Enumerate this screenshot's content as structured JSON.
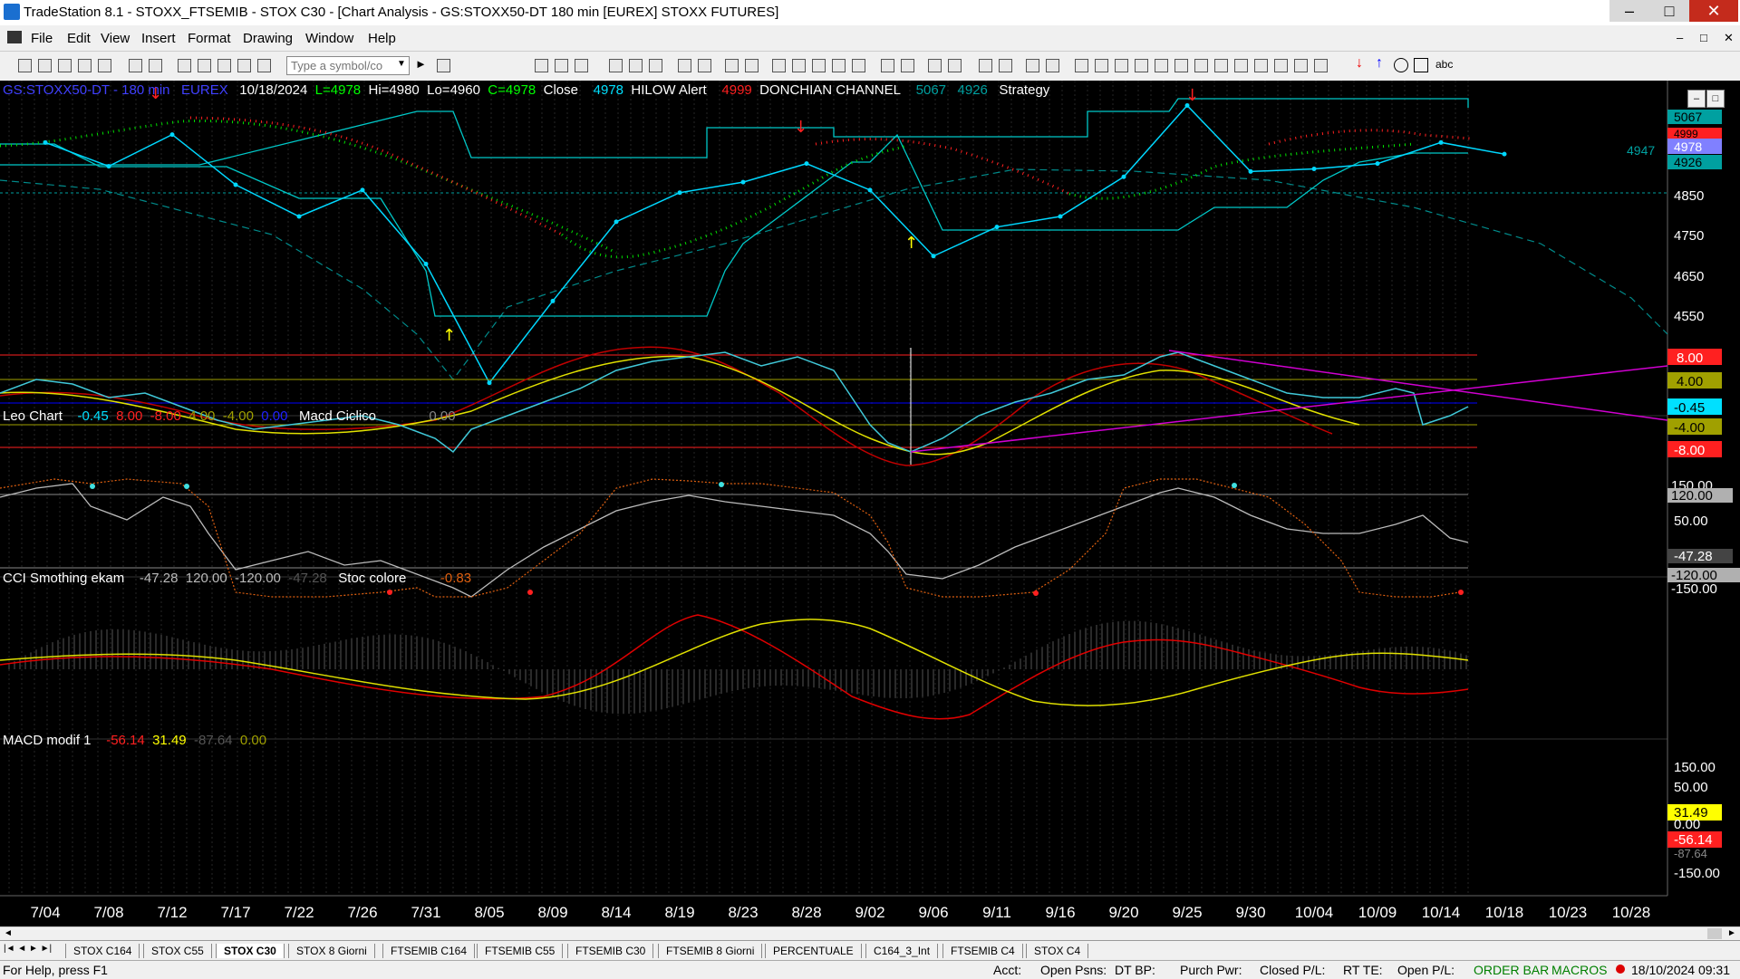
{
  "window": {
    "title": "TradeStation 8.1 - STOXX_FTSEMIB - STOX  C30 - [Chart Analysis - GS:STOXX50-DT  180 min  [EUREX] STOXX FUTURES]",
    "minimize": "–",
    "maximize": "□",
    "close": "✕"
  },
  "menu": [
    "File",
    "Edit",
    "View",
    "Insert",
    "Format",
    "Drawing",
    "Window",
    "Help"
  ],
  "toolbar": {
    "symbol_placeholder": "Type a symbol/co",
    "text_tool": "abc"
  },
  "header": {
    "symbol": "GS:STOXX50-DT - 180 min",
    "exchange": "EUREX",
    "date": "10/18/2024",
    "last": "L=4978",
    "hi": "Hi=4980",
    "lo": "Lo=4960",
    "close": "C=4978",
    "close_label": "Close",
    "close_val": "4978",
    "hilow": "HILOW Alert",
    "hilow_val": "4999",
    "donchian": "DONCHIAN CHANNEL",
    "don_up": "5067",
    "don_lo": "4926",
    "strategy": "Strategy"
  },
  "panel2": {
    "name": "Leo Chart",
    "v1": "-0.45",
    "v2": "8.00",
    "v3": "-8.00",
    "v4": "4.00",
    "v5": "-4.00",
    "v6": "0.00",
    "name2": "Macd Ciclico",
    "v7": "0.00"
  },
  "panel3": {
    "name": "CCI Smothing ekam",
    "v1": "-47.28",
    "v2": "120.00",
    "v3": "-120.00",
    "v4": "-47.28",
    "name2": "Stoc colore",
    "v5": "-0.83"
  },
  "panel4": {
    "name": "MACD modif 1",
    "v1": "-56.14",
    "v2": "31.49",
    "v3": "-87.64",
    "v4": "0.00"
  },
  "axis_price": [
    "4850",
    "4750",
    "4650",
    "4550"
  ],
  "axis_price_tags": {
    "up": "5067",
    "hilow": "4999",
    "close": "4978",
    "lo": "4926",
    "cursor": "4947"
  },
  "axis_leo": [
    "8.00",
    "4.00",
    "-0.45",
    "-4.00",
    "-8.00"
  ],
  "axis_cci": [
    "150.00",
    "120.00",
    "50.00",
    "-47.28",
    "-120.00",
    "-150.00"
  ],
  "axis_macd": [
    "150.00",
    "50.00",
    "31.49",
    "0.00",
    "-56.14",
    "-87.64",
    "-150.00"
  ],
  "dates": [
    "7/04",
    "7/08",
    "7/12",
    "7/17",
    "7/22",
    "7/26",
    "7/31",
    "8/05",
    "8/09",
    "8/14",
    "8/19",
    "8/23",
    "8/28",
    "9/02",
    "9/06",
    "9/11",
    "9/16",
    "9/20",
    "9/25",
    "9/30",
    "10/04",
    "10/09",
    "10/14",
    "10/18",
    "10/23",
    "10/28"
  ],
  "tabs": [
    "STOX C164",
    "STOX C55",
    "STOX  C30",
    "STOX 8 Giorni",
    "FTSEMIB C164",
    "FTSEMIB C55",
    "FTSEMIB C30",
    "FTSEMIB  8 Giorni",
    "PERCENTUALE",
    "C164_3_Int",
    "FTSEMIB C4",
    "STOX  C4"
  ],
  "status": {
    "help": "For Help, press F1",
    "acct": "Acct:",
    "open_psns": "Open Psns:",
    "dt_bp": "DT BP:",
    "purch_pwr": "Purch Pwr:",
    "closed_pl": "Closed P/L:",
    "rt_te": "RT TE:",
    "open_pl": "Open P/L:",
    "order_bar": "ORDER BAR",
    "macros": "MACROS",
    "datetime": "18/10/2024 09:31"
  },
  "chart_data": {
    "type": "line",
    "title": "GS:STOXX50-DT - 180 min",
    "x": [
      "7/04",
      "7/08",
      "7/12",
      "7/17",
      "7/22",
      "7/26",
      "7/31",
      "8/05",
      "8/09",
      "8/14",
      "8/19",
      "8/23",
      "8/28",
      "9/02",
      "9/06",
      "9/11",
      "9/16",
      "9/20",
      "9/25",
      "9/30",
      "10/04",
      "10/09",
      "10/14",
      "10/18"
    ],
    "series": [
      {
        "name": "Close",
        "values": [
          5000,
          4955,
          5015,
          4920,
          4860,
          4910,
          4770,
          4545,
          4700,
          4850,
          4905,
          4925,
          4960,
          4910,
          4785,
          4840,
          4860,
          4935,
          5070,
          4945,
          4950,
          4960,
          5000,
          4978
        ]
      }
    ],
    "ylim": [
      4500,
      5100
    ],
    "colors": {
      "price": "#00d8ff",
      "donchian": "#00c8c8",
      "hilow_high": "#ff2020",
      "hilow_low": "#00ff00"
    }
  }
}
